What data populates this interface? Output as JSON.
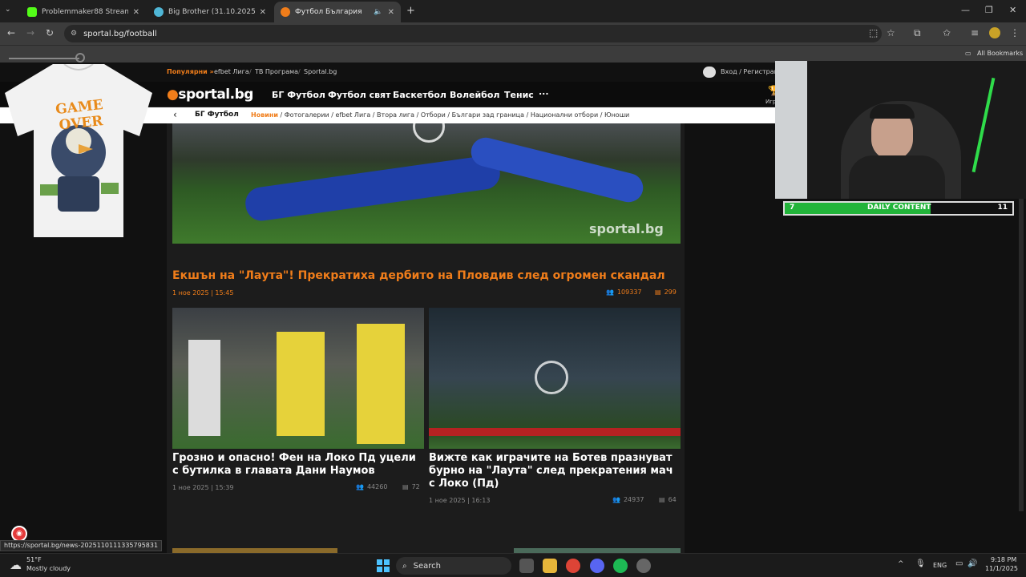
{
  "browser": {
    "tabs": [
      {
        "title": "Problemmaker88 Stream - Watc",
        "color": "#53fc18"
      },
      {
        "title": "Big Brother (31.10.2025) - Сезо",
        "color": "#4fb6d6"
      },
      {
        "title": "Футбол България",
        "color": "#f07d1a"
      }
    ],
    "url": "sportal.bg/football",
    "all_bookmarks": "All Bookmarks",
    "status_url": "https://sportal.bg/news-2025110111335795831"
  },
  "site": {
    "top_links": {
      "popular": "Популярни »",
      "items": [
        "efbet Лига",
        "ТВ Програма",
        "Sportal.bg"
      ],
      "login": "Вход / Регистрация"
    },
    "logo": {
      "dot": "●",
      "text": "sportal.bg"
    },
    "nav": [
      "БГ Футбол",
      "Футбол свят",
      "Баскетбол",
      "Волейбол",
      "Тенис"
    ],
    "nav_more": "...",
    "games_label": "Игр",
    "subnav": {
      "back": "‹",
      "section": "БГ Футбол",
      "active": "Новини",
      "items": [
        "Фотогалерии",
        "efbet Лига",
        "Втора лига",
        "Отбори",
        "Българи зад граница",
        "Национални отбори",
        "Юноши"
      ]
    },
    "main_story": {
      "headline": "Екшън на \"Лаута\"! Прекратиха дербито на Пловдив след огромен скандал",
      "date": "1 ное 2025 | 15:45",
      "views": "109337",
      "comments": "299",
      "watermark": "sportal.bg"
    },
    "stories": [
      {
        "headline": "Грозно и опасно! Фен на Локо Пд уцели с бутилка в главата Дани Наумов",
        "date": "1 ное 2025 | 15:39",
        "views": "44260",
        "comments": "72"
      },
      {
        "headline": "Вижте как играчите на Ботев празнуват бурно на \"Лаута\" след прекратения мач с Локо (Пд)",
        "date": "1 ное 2025 | 16:13",
        "views": "24937",
        "comments": "64"
      }
    ]
  },
  "overlay": {
    "shirt_text": "GAME OVER",
    "daily_count": "7",
    "daily_label": "DAILY CONTENT",
    "daily_total": "11",
    "daily_progress": 0.64
  },
  "taskbar": {
    "weather_temp": "51°F",
    "weather_desc": "Mostly cloudy",
    "search_label": "Search",
    "lang": "ENG",
    "time": "9:18 PM",
    "date": "11/1/2025"
  }
}
